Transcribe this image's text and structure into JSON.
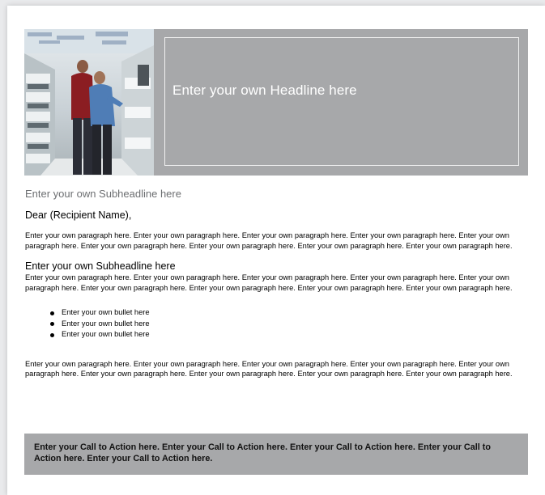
{
  "banner": {
    "headline": "Enter your own Headline here"
  },
  "body": {
    "subheadline_top": "Enter your own Subheadline here",
    "salutation": "Dear (Recipient Name),",
    "paragraph_1": "Enter your own paragraph here. Enter your own paragraph here. Enter your own paragraph here. Enter your own paragraph here. Enter your own paragraph here. Enter your own paragraph here. Enter your own paragraph here. Enter your own paragraph here. Enter your own paragraph here.",
    "subheadline_2": "Enter your own Subheadline here",
    "paragraph_2": "Enter your own paragraph here. Enter your own paragraph here. Enter your own paragraph here. Enter your own paragraph here. Enter your own paragraph here. Enter your own paragraph here. Enter your own paragraph here. Enter your own paragraph here. Enter your own paragraph here.",
    "bullets": [
      "Enter your own bullet here",
      "Enter your own bullet here",
      "Enter your own bullet here"
    ],
    "paragraph_3": "Enter your own paragraph here. Enter your own paragraph here. Enter your own paragraph here. Enter your own paragraph here. Enter your own paragraph here. Enter your own paragraph here. Enter your own paragraph here. Enter your own paragraph here. Enter your own paragraph here."
  },
  "cta": {
    "text": "Enter your Call to Action here. Enter your Call to Action here. Enter your Call to Action here. Enter your Call to Action here. Enter your Call to Action here."
  },
  "colors": {
    "banner_gray": "#a7a8aa",
    "subheadline_gray": "#6d6f72",
    "page_white": "#ffffff"
  }
}
